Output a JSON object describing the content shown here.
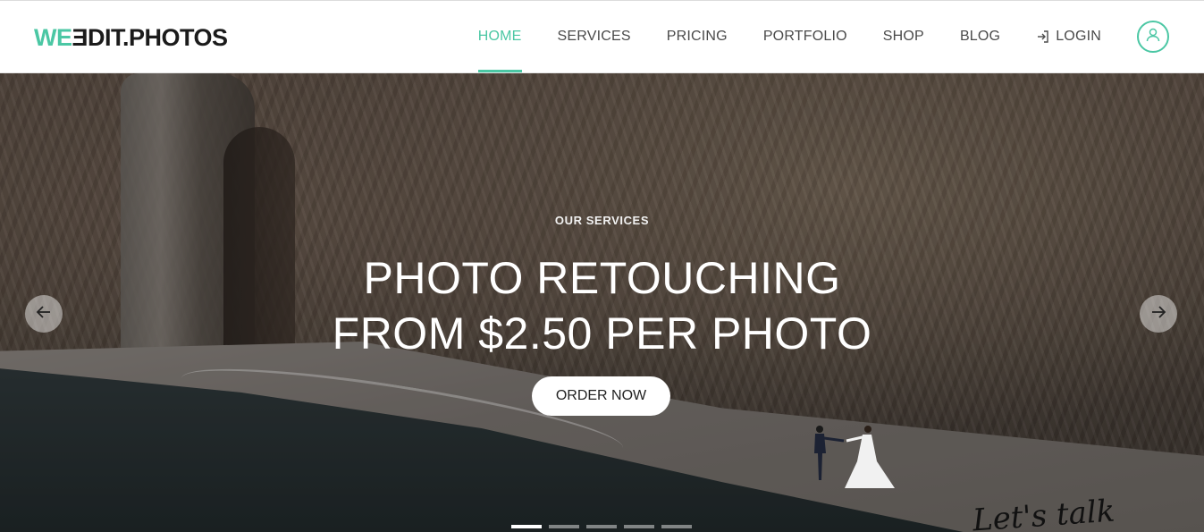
{
  "logo": {
    "we": "WE",
    "mirrored_e": "E",
    "rest": "DIT.PHOTOS"
  },
  "nav": {
    "items": [
      {
        "label": "HOME",
        "active": true
      },
      {
        "label": "SERVICES",
        "active": false
      },
      {
        "label": "PRICING",
        "active": false
      },
      {
        "label": "PORTFOLIO",
        "active": false
      },
      {
        "label": "SHOP",
        "active": false
      },
      {
        "label": "BLOG",
        "active": false
      }
    ],
    "login_label": "LOGIN",
    "login_icon": "login-icon",
    "account_icon": "user-icon"
  },
  "hero": {
    "eyebrow": "OUR SERVICES",
    "headline_line1": "PHOTO RETOUCHING",
    "headline_line2": "FROM $2.50 PER PHOTO",
    "cta_label": "ORDER NOW",
    "prev_icon": "arrow-left-icon",
    "next_icon": "arrow-right-icon",
    "slide_count": 5,
    "active_slide": 1,
    "script_text": "Let's talk"
  },
  "colors": {
    "accent": "#4bc7a4",
    "nav_text": "#4a4a4a",
    "logo_dark": "#1b1b1b"
  }
}
